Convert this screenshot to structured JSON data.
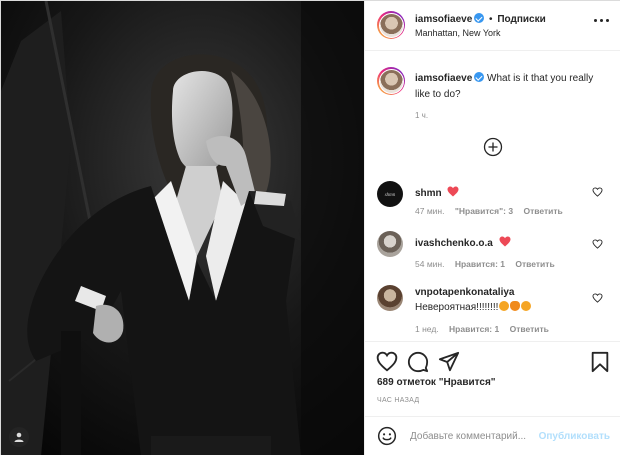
{
  "post": {
    "username": "iamsofiaeve",
    "dot": "•",
    "follow_label": "Подписки",
    "location": "Manhattan, New York",
    "caption": "What is it that you really like to do?",
    "caption_time": "1 ч."
  },
  "comments": [
    {
      "username": "shmn",
      "time": "47 мин.",
      "likes": "\"Нравится\": 3",
      "reply": "Ответить",
      "text": ""
    },
    {
      "username": "ivashchenko.o.a",
      "time": "54 мин.",
      "likes": "Нравится: 1",
      "reply": "Ответить",
      "text": ""
    },
    {
      "username": "vnpotapenkonataliya",
      "time": "1 нед.",
      "likes": "Нравится: 1",
      "reply": "Ответить",
      "text": "Невероятная!!!!!!!!"
    }
  ],
  "stats": {
    "likes_text": "689 отметок \"Нравится\"",
    "posted": "ЧАС НАЗАД"
  },
  "add_comment": {
    "placeholder": "Добавьте комментарий...",
    "publish": "Опубликовать"
  },
  "icons": {
    "more": "more-horizontal-icon",
    "load_more": "plus-circle-icon",
    "like": "heart-outline-icon",
    "comment": "comment-bubble-icon",
    "share": "paper-plane-icon",
    "save": "bookmark-icon",
    "emoji": "smiley-icon",
    "tag": "user-tag-icon"
  },
  "colors": {
    "heart_red": "#ed4956",
    "verified_blue": "#3897f0",
    "publish_disabled": "#b2dffc",
    "muted_text": "#8e8e8e"
  }
}
